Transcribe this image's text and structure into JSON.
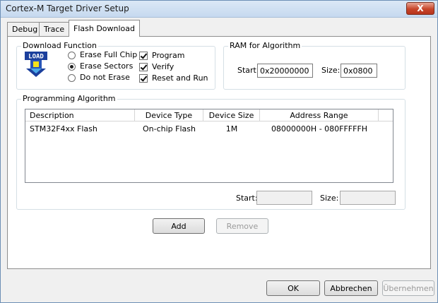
{
  "window": {
    "title": "Cortex-M Target Driver Setup",
    "close_glyph": "X"
  },
  "tabs": [
    {
      "label": "Debug"
    },
    {
      "label": "Trace"
    },
    {
      "label": "Flash Download",
      "active": true
    }
  ],
  "download_function": {
    "group_label": "Download Function",
    "icon": "load-icon",
    "icon_text": "LOAD",
    "radios": [
      {
        "label": "Erase Full Chip",
        "checked": false
      },
      {
        "label": "Erase Sectors",
        "checked": true
      },
      {
        "label": "Do not Erase",
        "checked": false
      }
    ],
    "checkboxes": [
      {
        "label": "Program",
        "checked": true
      },
      {
        "label": "Verify",
        "checked": true
      },
      {
        "label": "Reset and Run",
        "checked": true
      }
    ]
  },
  "ram_for_algorithm": {
    "group_label": "RAM for Algorithm",
    "start_label": "Start:",
    "start_value": "0x20000000",
    "size_label": "Size:",
    "size_value": "0x0800"
  },
  "programming_algorithm": {
    "group_label": "Programming Algorithm",
    "columns": [
      "Description",
      "Device Type",
      "Device Size",
      "Address Range"
    ],
    "rows": [
      [
        "STM32F4xx Flash",
        "On-chip Flash",
        "1M",
        "08000000H - 080FFFFFH"
      ]
    ],
    "start_label": "Start:",
    "start_value": "",
    "size_label": "Size:",
    "size_value": ""
  },
  "actions": {
    "add_label": "Add",
    "remove_label": "Remove"
  },
  "footer": {
    "ok_label": "OK",
    "cancel_label": "Abbrechen",
    "apply_label": "Übernehmen"
  },
  "colors": {
    "title_bar": "#c6d9ef",
    "close_button": "#c7452a",
    "panel_bg": "#ffffff",
    "dialog_bg": "#f0f0f0"
  }
}
